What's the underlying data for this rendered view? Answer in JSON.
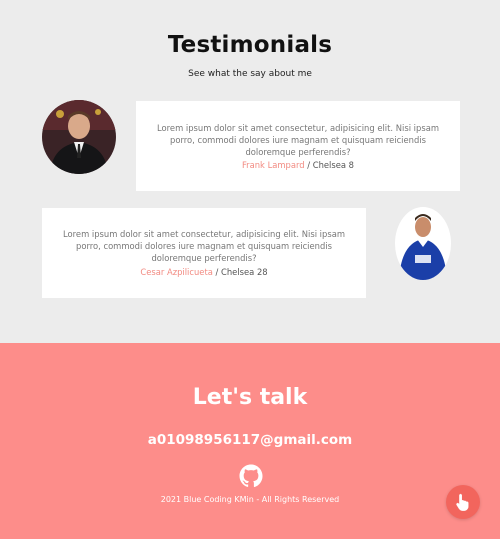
{
  "testimonials": {
    "title": "Testimonials",
    "subtitle": "See what the say about me",
    "items": [
      {
        "text": "Lorem ipsum dolor sit amet consectetur, adipisicing elit. Nisi ipsam porro, commodi dolores iure magnam et quisquam reiciendis doloremque perferendis?",
        "author": "Frank Lampard",
        "team": " / Chelsea 8",
        "avatar": "person-portrait-suit"
      },
      {
        "text": "Lorem ipsum dolor sit amet consectetur, adipisicing elit. Nisi ipsam porro, commodi dolores iure magnam et quisquam reiciendis doloremque perferendis?",
        "author": "Cesar Azpilicueta",
        "team": " / Chelsea 28",
        "avatar": "person-portrait-blue-jersey"
      }
    ]
  },
  "footer": {
    "title": "Let's talk",
    "email": "a01098956117@gmail.com",
    "github_icon": "github-icon",
    "copyright": "2021 Blue Coding KMin - All Rights Reserved",
    "fab_icon": "hand-pointer-icon"
  },
  "colors": {
    "accent": "#fd8d8a",
    "author_link": "#f28b82",
    "fab": "#f2655d",
    "background": "#ececec"
  }
}
